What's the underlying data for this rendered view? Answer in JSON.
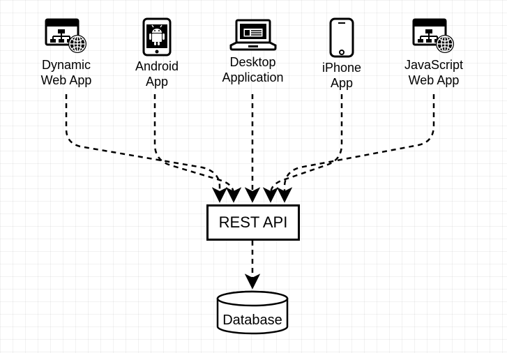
{
  "diagram": {
    "clients": [
      {
        "label_line1": "Dynamic",
        "label_line2": "Web App"
      },
      {
        "label_line1": "Android",
        "label_line2": "App"
      },
      {
        "label_line1": "Desktop",
        "label_line2": "Application"
      },
      {
        "label_line1": "iPhone",
        "label_line2": "App"
      },
      {
        "label_line1": "JavaScript",
        "label_line2": "Web App"
      }
    ],
    "rest_api_label": "REST API",
    "database_label": "Database"
  }
}
